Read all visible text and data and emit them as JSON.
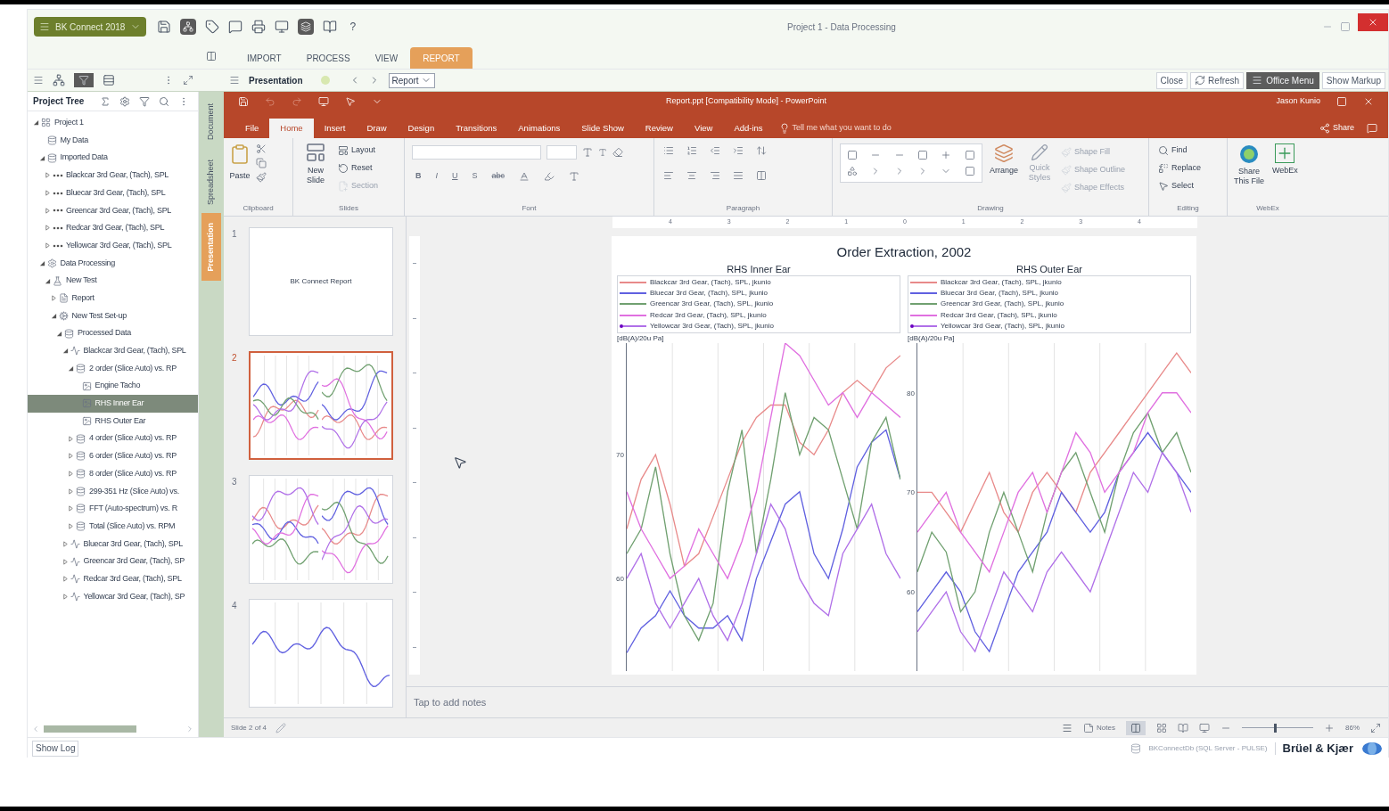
{
  "app_menu": {
    "label": "BK Connect 2018"
  },
  "window": {
    "title": "Project 1 - Data Processing",
    "help": "?"
  },
  "main_tabs": [
    {
      "label": "IMPORT",
      "selected": false
    },
    {
      "label": "PROCESS",
      "selected": false
    },
    {
      "label": "VIEW",
      "selected": false
    },
    {
      "label": "REPORT",
      "selected": true
    }
  ],
  "toolbar": {
    "title": "Presentation",
    "report_select": "Report",
    "buttons": [
      {
        "label": "Close",
        "kind": "plain"
      },
      {
        "label": "Refresh",
        "kind": "refresh"
      },
      {
        "label": "Office Menu",
        "kind": "menu"
      },
      {
        "label": "Show Markup",
        "kind": "plain"
      }
    ]
  },
  "project_tree": {
    "title": "Project Tree",
    "items": [
      {
        "label": "Project 1",
        "kind": "project",
        "expanded": true,
        "selected": false,
        "children": [
          {
            "label": "My Data",
            "kind": "data",
            "selected": false
          },
          {
            "label": "Imported Data",
            "kind": "data",
            "expanded": true,
            "selected": false,
            "children": [
              {
                "label": "Blackcar 3rd Gear, (Tach), SPL",
                "kind": "signal",
                "expanded": false,
                "selected": false
              },
              {
                "label": "Bluecar 3rd Gear, (Tach), SPL",
                "kind": "signal",
                "expanded": false,
                "selected": false
              },
              {
                "label": "Greencar 3rd Gear, (Tach), SPL",
                "kind": "signal",
                "expanded": false,
                "selected": false
              },
              {
                "label": "Redcar 3rd Gear, (Tach), SPL",
                "kind": "signal",
                "expanded": false,
                "selected": false
              },
              {
                "label": "Yellowcar 3rd Gear, (Tach), SPL",
                "kind": "signal",
                "expanded": false,
                "selected": false
              }
            ]
          },
          {
            "label": "Data Processing",
            "kind": "gear",
            "expanded": true,
            "selected": false,
            "children": [
              {
                "label": "New Test",
                "kind": "test",
                "expanded": true,
                "selected": false,
                "children": [
                  {
                    "label": "Report",
                    "kind": "report",
                    "expanded": false,
                    "selected": false
                  },
                  {
                    "label": "New Test Set-up",
                    "kind": "setup",
                    "expanded": true,
                    "selected": false,
                    "children": [
                      {
                        "label": "Processed Data",
                        "kind": "data",
                        "expanded": true,
                        "selected": false,
                        "children": [
                          {
                            "label": "Blackcar 3rd Gear, (Tach), SPL",
                            "kind": "chart",
                            "expanded": true,
                            "selected": false,
                            "children": [
                              {
                                "label": "2 order (Slice Auto) vs. RP",
                                "kind": "data",
                                "expanded": true,
                                "selected": false,
                                "children": [
                                  {
                                    "label": "Engine Tacho",
                                    "kind": "graph",
                                    "selected": false
                                  },
                                  {
                                    "label": "RHS Inner Ear",
                                    "kind": "graph",
                                    "selected": true
                                  },
                                  {
                                    "label": "RHS Outer Ear",
                                    "kind": "graph",
                                    "selected": false
                                  }
                                ]
                              },
                              {
                                "label": "4 order (Slice Auto) vs. RP",
                                "kind": "data",
                                "expanded": false,
                                "selected": false
                              },
                              {
                                "label": "6 order (Slice Auto) vs. RP",
                                "kind": "data",
                                "expanded": false,
                                "selected": false
                              },
                              {
                                "label": "8 order (Slice Auto) vs. RP",
                                "kind": "data",
                                "expanded": false,
                                "selected": false
                              },
                              {
                                "label": "299-351 Hz (Slice Auto) vs.",
                                "kind": "data",
                                "expanded": false,
                                "selected": false
                              },
                              {
                                "label": "FFT (Auto-spectrum) vs. R",
                                "kind": "data",
                                "expanded": false,
                                "selected": false
                              },
                              {
                                "label": "Total (Slice Auto) vs. RPM",
                                "kind": "data",
                                "expanded": false,
                                "selected": false
                              }
                            ]
                          },
                          {
                            "label": "Bluecar 3rd Gear, (Tach), SPL",
                            "kind": "chart",
                            "expanded": false,
                            "selected": false
                          },
                          {
                            "label": "Greencar 3rd Gear, (Tach), SP",
                            "kind": "chart",
                            "expanded": false,
                            "selected": false
                          },
                          {
                            "label": "Redcar 3rd Gear, (Tach), SPL",
                            "kind": "chart",
                            "expanded": false,
                            "selected": false
                          },
                          {
                            "label": "Yellowcar 3rd Gear, (Tach), SP",
                            "kind": "chart",
                            "expanded": false,
                            "selected": false
                          }
                        ]
                      }
                    ]
                  }
                ]
              }
            ]
          }
        ]
      }
    ]
  },
  "side_tabs": [
    {
      "label": "Document",
      "selected": false
    },
    {
      "label": "Spreadsheet",
      "selected": false
    },
    {
      "label": "Presentation",
      "selected": true
    }
  ],
  "powerpoint": {
    "title": "Report.ppt [Compatibility Mode] - PowerPoint",
    "user": "Jason Kunio",
    "tabs": [
      {
        "label": "File",
        "selected": false
      },
      {
        "label": "Home",
        "selected": true
      },
      {
        "label": "Insert",
        "selected": false
      },
      {
        "label": "Draw",
        "selected": false
      },
      {
        "label": "Design",
        "selected": false
      },
      {
        "label": "Transitions",
        "selected": false
      },
      {
        "label": "Animations",
        "selected": false
      },
      {
        "label": "Slide Show",
        "selected": false
      },
      {
        "label": "Review",
        "selected": false
      },
      {
        "label": "View",
        "selected": false
      },
      {
        "label": "Add-ins",
        "selected": false
      }
    ],
    "tell_me": "Tell me what you want to do",
    "share": "Share",
    "ribbon": {
      "clipboard": {
        "label": "Clipboard",
        "paste": "Paste"
      },
      "slides": {
        "label": "Slides",
        "new_slide": "New Slide",
        "small": [
          {
            "label": "Layout",
            "disabled": false
          },
          {
            "label": "Reset",
            "disabled": false
          },
          {
            "label": "Section",
            "disabled": true
          }
        ]
      },
      "font": {
        "label": "Font",
        "format_buttons": [
          "B",
          "I",
          "U",
          "S",
          "abc"
        ]
      },
      "paragraph": {
        "label": "Paragraph"
      },
      "drawing": {
        "label": "Drawing",
        "arrange": "Arrange",
        "quick_styles": "Quick Styles",
        "small": [
          {
            "label": "Shape Fill",
            "disabled": true
          },
          {
            "label": "Shape Outline",
            "disabled": true
          },
          {
            "label": "Shape Effects",
            "disabled": true
          }
        ]
      },
      "editing": {
        "label": "Editing",
        "small": [
          {
            "label": "Find",
            "disabled": false
          },
          {
            "label": "Replace",
            "disabled": false
          },
          {
            "label": "Select",
            "disabled": false
          }
        ]
      },
      "webex": {
        "label": "WebEx",
        "share": "Share This File",
        "webex": "WebEx"
      }
    },
    "slides": [
      {
        "number": "1",
        "kind": "title",
        "title": "BK Connect Report",
        "selected": false
      },
      {
        "number": "2",
        "kind": "charts",
        "selected": true
      },
      {
        "number": "3",
        "kind": "charts",
        "selected": false
      },
      {
        "number": "4",
        "kind": "single",
        "selected": false
      }
    ],
    "ruler_labels": [
      "4",
      "3",
      "2",
      "1",
      "0",
      "1",
      "2",
      "3",
      "4"
    ],
    "slide": {
      "title": "Order Extraction, 2002",
      "charts": [
        {
          "chart_data": {
            "type": "line",
            "title": "RHS Inner Ear",
            "ylabel": "[dB(A)/20u Pa]",
            "ylim": [
              52.5,
              79
            ],
            "yticks": [
              70,
              60
            ],
            "series": [
              {
                "name": "Blackcar 3rd Gear, (Tach), SPL, jkunio",
                "color": "#e88a8a",
                "values": [
                  64,
                  68,
                  70,
                  66,
                  61,
                  62,
                  65,
                  68,
                  71,
                  73,
                  74,
                  74,
                  71,
                  70,
                  72,
                  75,
                  76,
                  75,
                  77,
                  78
                ]
              },
              {
                "name": "Bluecar 3rd Gear, (Tach), SPL, jkunio",
                "color": "#6060e0",
                "values": [
                  54,
                  56,
                  57,
                  59,
                  57,
                  56,
                  56,
                  57,
                  55,
                  60,
                  63,
                  66,
                  67,
                  62,
                  60,
                  64,
                  69,
                  71,
                  72,
                  68
                ]
              },
              {
                "name": "Greencar 3rd Gear, (Tach), SPL, jkunio",
                "color": "#70a070",
                "values": [
                  62,
                  64,
                  69,
                  62,
                  57,
                  55,
                  58,
                  67,
                  72,
                  62,
                  68,
                  75,
                  70,
                  73,
                  72,
                  68,
                  64,
                  71,
                  73,
                  68
                ]
              },
              {
                "name": "Redcar 3rd Gear, (Tach), SPL, jkunio",
                "color": "#e070e0",
                "values": [
                  67,
                  64,
                  62,
                  60,
                  61,
                  64,
                  62,
                  60,
                  63,
                  67,
                  73,
                  79,
                  78,
                  76,
                  74,
                  75,
                  73,
                  75,
                  74,
                  73
                ]
              },
              {
                "name": "Yellowcar 3rd Gear, (Tach), SPL, jkunio",
                "color": "#b070e8",
                "marker": true,
                "values": [
                  60,
                  62,
                  58,
                  56,
                  58,
                  60,
                  57,
                  55,
                  58,
                  62,
                  66,
                  64,
                  60,
                  58,
                  57,
                  62,
                  64,
                  66,
                  62,
                  60
                ]
              }
            ]
          }
        },
        {
          "chart_data": {
            "type": "line",
            "title": "RHS Outer Ear",
            "ylabel": "[dB(A)/20u Pa]",
            "ylim": [
              52,
              85
            ],
            "yticks": [
              80,
              70,
              60
            ],
            "series": [
              {
                "name": "Blackcar 3rd Gear, (Tach), SPL, jkunio",
                "color": "#e88a8a",
                "values": [
                  70,
                  70,
                  68,
                  66,
                  69,
                  72,
                  68,
                  66,
                  70,
                  72,
                  70,
                  68,
                  72,
                  74,
                  76,
                  78,
                  80,
                  82,
                  84,
                  82
                ]
              },
              {
                "name": "Bluecar 3rd Gear, (Tach), SPL, jkunio",
                "color": "#6060e0",
                "values": [
                  58,
                  60,
                  62,
                  60,
                  56,
                  54,
                  58,
                  62,
                  64,
                  66,
                  70,
                  68,
                  66,
                  68,
                  72,
                  74,
                  76,
                  74,
                  72,
                  70
                ]
              },
              {
                "name": "Greencar 3rd Gear, (Tach), SPL, jkunio",
                "color": "#70a070",
                "values": [
                  62,
                  66,
                  64,
                  58,
                  60,
                  66,
                  70,
                  66,
                  62,
                  68,
                  72,
                  74,
                  70,
                  66,
                  72,
                  76,
                  78,
                  74,
                  76,
                  72
                ]
              },
              {
                "name": "Redcar 3rd Gear, (Tach), SPL, jkunio",
                "color": "#e070e0",
                "values": [
                  66,
                  68,
                  70,
                  66,
                  64,
                  62,
                  66,
                  70,
                  72,
                  68,
                  72,
                  76,
                  74,
                  70,
                  72,
                  74,
                  78,
                  80,
                  80,
                  78
                ]
              },
              {
                "name": "Yellowcar 3rd Gear, (Tach), SPL, jkunio",
                "color": "#b070e8",
                "marker": true,
                "values": [
                  56,
                  58,
                  60,
                  56,
                  54,
                  58,
                  62,
                  60,
                  58,
                  62,
                  64,
                  62,
                  60,
                  64,
                  68,
                  72,
                  70,
                  74,
                  72,
                  68
                ]
              }
            ]
          }
        }
      ]
    },
    "notes_placeholder": "Tap to add notes",
    "status": {
      "slide": "Slide 2 of 4",
      "notes": "Notes",
      "zoom": "86%",
      "zoom_level": {
        "level": 0.45
      }
    }
  },
  "status_bar": {
    "show_log": "Show Log",
    "database": "BKConnectDb (SQL Server - PULSE)",
    "brand": "Brüel & Kjær"
  }
}
